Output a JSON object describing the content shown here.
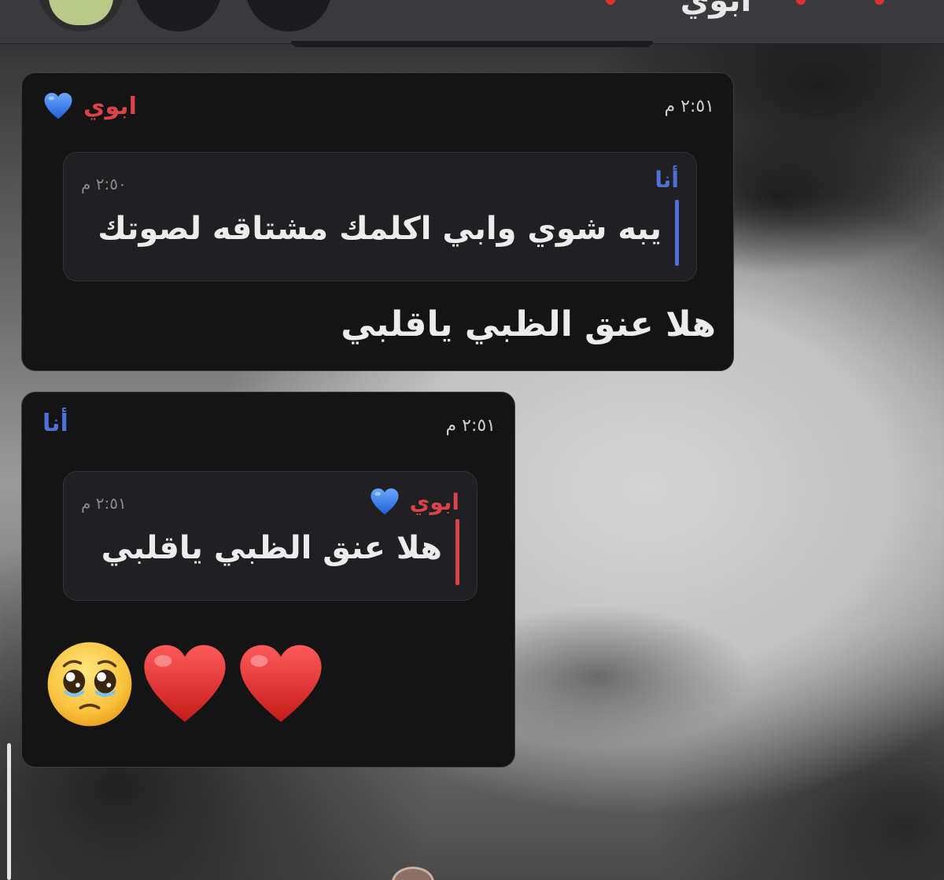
{
  "header": {
    "title": "ابوي"
  },
  "messages": [
    {
      "sender": "ابوي",
      "sender_icon": "blue-heart-icon",
      "time": "٢:٥١ م",
      "reply_to": {
        "sender": "أنا",
        "time": "٢:٥٠ م",
        "text": "يبه شوي وابي اكلمك مشتاقه لصوتك"
      },
      "text": "هلا عنق الظبي ياقلبي"
    },
    {
      "sender": "أنا",
      "time": "٢:٥١ م",
      "reply_to": {
        "sender": "ابوي",
        "sender_icon": "blue-heart-icon",
        "time": "٢:٥١ م",
        "text": "هلا عنق الظبي ياقلبي"
      },
      "emojis": [
        "pleading-face-icon",
        "red-heart-icon",
        "red-heart-icon"
      ]
    }
  ],
  "colors": {
    "card_bg": "#141414",
    "quote_bg": "#202022",
    "name_red": "#d9434b",
    "name_blue": "#4f6fd9",
    "heart_blue": "#3b82f6",
    "heart_red": "#d92b2b"
  }
}
